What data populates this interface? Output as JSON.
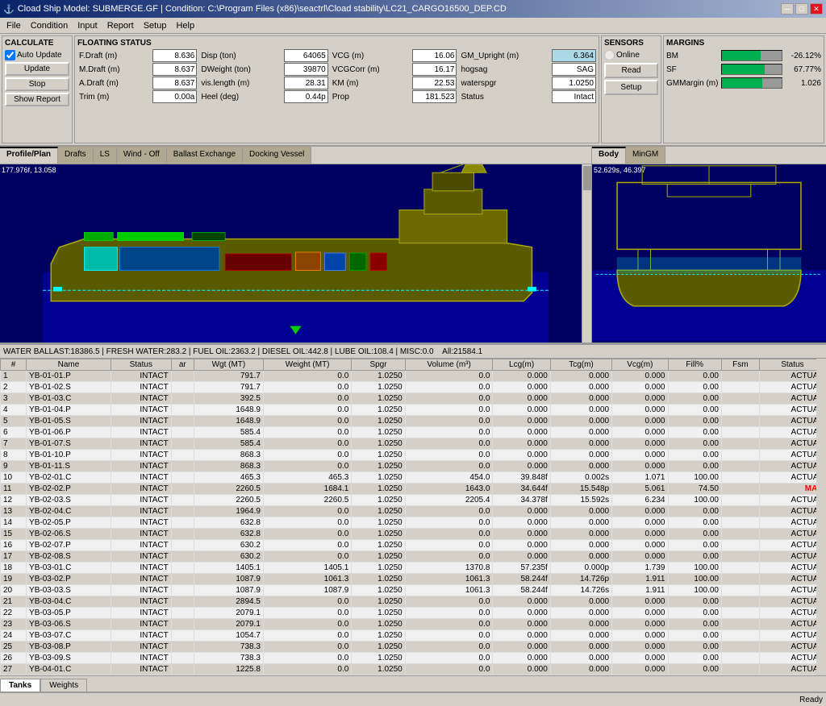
{
  "titleBar": {
    "title": "Cload Ship Model: SUBMERGE.GF | Condition: C:\\Program Files (x86)\\seactrl\\Cload stability\\LC21_CARGO16500_DEP.CD",
    "icon": "ship-icon"
  },
  "menuBar": {
    "items": [
      "File",
      "Condition",
      "Input",
      "Report",
      "Setup",
      "Help"
    ]
  },
  "calculate": {
    "title": "CALCULATE",
    "autoUpdate": "Auto Update",
    "updateBtn": "Update",
    "stopBtn": "Stop",
    "showReportBtn": "Show Report"
  },
  "floatingStatus": {
    "title": "FLOATING STATUS",
    "fields": [
      {
        "label": "F.Draft (m)",
        "value": "8.636"
      },
      {
        "label": "Disp (ton)",
        "value": "64065"
      },
      {
        "label": "VCG (m)",
        "value": "16.06"
      },
      {
        "label": "GM_Upright (m)",
        "value": "6.364"
      },
      {
        "label": "M.Draft (m)",
        "value": "8.637"
      },
      {
        "label": "DWeight (ton)",
        "value": "39870"
      },
      {
        "label": "VCGCorr (m)",
        "value": "16.17"
      },
      {
        "label": "hogsag",
        "value": "SAG"
      },
      {
        "label": "A.Draft (m)",
        "value": "8.637"
      },
      {
        "label": "vis.length (m)",
        "value": "28.31"
      },
      {
        "label": "KM (m)",
        "value": "22.53"
      },
      {
        "label": "waterspgr",
        "value": "1.0250"
      },
      {
        "label": "Trim (m)",
        "value": "0.00a"
      },
      {
        "label": "Heel (deg)",
        "value": "0.44p"
      },
      {
        "label": "Prop",
        "value": "181.523"
      },
      {
        "label": "Status",
        "value": "Intact"
      }
    ]
  },
  "sensors": {
    "title": "SENSORS",
    "onlineBtn": "Online",
    "readBtn": "Read",
    "setupBtn": "Setup"
  },
  "margins": {
    "title": "MARGINS",
    "items": [
      {
        "label": "BM",
        "value": "-26.12%",
        "percent": 65
      },
      {
        "label": "SF",
        "value": "67.77%",
        "percent": 72
      },
      {
        "label": "GMMargin (m)",
        "value": "1.026",
        "percent": 68
      }
    ]
  },
  "profileTabs": [
    "Profile/Plan",
    "Drafts",
    "LS",
    "Wind - Off",
    "Ballast Exchange",
    "Docking Vessel"
  ],
  "profileActiveTab": 0,
  "profileCoords": "177.976f, 13.058",
  "bodyTabs": [
    "Body",
    "MinGM"
  ],
  "bodyActiveTab": 0,
  "bodyCoords": "52.629s, 46.397",
  "ballastBar": "WATER BALLAST:18386.5 | FRESH WATER:283.2 | FUEL OIL:2363.2 | DIESEL OIL:442.8 | LUBE OIL:108.4 | MISC:0.0   All:21584.1",
  "tableHeaders": [
    "#",
    "Name",
    "Status",
    "ar",
    "Wgt (MT)",
    "Weight (MT)",
    "Spgr",
    "Volume (m³)",
    "Lcg(m)",
    "Tcg(m)",
    "Vcg(m)",
    "Fill%",
    "Fsm",
    "Status"
  ],
  "tableRows": [
    [
      "1",
      "YB-01-01.P",
      "INTACT",
      "",
      "791.7",
      "0.0",
      "1.0250",
      "0.0",
      "0.000",
      "0.000",
      "0.000",
      "0.00",
      "",
      "ACTUAL"
    ],
    [
      "2",
      "YB-01-02.S",
      "INTACT",
      "",
      "791.7",
      "0.0",
      "1.0250",
      "0.0",
      "0.000",
      "0.000",
      "0.000",
      "0.00",
      "",
      "ACTUAL"
    ],
    [
      "3",
      "YB-01-03.C",
      "INTACT",
      "",
      "392.5",
      "0.0",
      "1.0250",
      "0.0",
      "0.000",
      "0.000",
      "0.000",
      "0.00",
      "",
      "ACTUAL"
    ],
    [
      "4",
      "YB-01-04.P",
      "INTACT",
      "",
      "1648.9",
      "0.0",
      "1.0250",
      "0.0",
      "0.000",
      "0.000",
      "0.000",
      "0.00",
      "",
      "ACTUAL"
    ],
    [
      "5",
      "YB-01-05.S",
      "INTACT",
      "",
      "1648.9",
      "0.0",
      "1.0250",
      "0.0",
      "0.000",
      "0.000",
      "0.000",
      "0.00",
      "",
      "ACTUAL"
    ],
    [
      "6",
      "YB-01-06.P",
      "INTACT",
      "",
      "585.4",
      "0.0",
      "1.0250",
      "0.0",
      "0.000",
      "0.000",
      "0.000",
      "0.00",
      "",
      "ACTUAL"
    ],
    [
      "7",
      "YB-01-07.S",
      "INTACT",
      "",
      "585.4",
      "0.0",
      "1.0250",
      "0.0",
      "0.000",
      "0.000",
      "0.000",
      "0.00",
      "",
      "ACTUAL"
    ],
    [
      "8",
      "YB-01-10.P",
      "INTACT",
      "",
      "868.3",
      "0.0",
      "1.0250",
      "0.0",
      "0.000",
      "0.000",
      "0.000",
      "0.00",
      "",
      "ACTUAL"
    ],
    [
      "9",
      "YB-01-11.S",
      "INTACT",
      "",
      "868.3",
      "0.0",
      "1.0250",
      "0.0",
      "0.000",
      "0.000",
      "0.000",
      "0.00",
      "",
      "ACTUAL"
    ],
    [
      "10",
      "YB-02-01.C",
      "INTACT",
      "",
      "465.3",
      "465.3",
      "1.0250",
      "454.0",
      "39.848f",
      "0.002s",
      "1.071",
      "100.00",
      "",
      "ACTUAL"
    ],
    [
      "11",
      "YB-02-02.P",
      "INTACT",
      "",
      "2260.5",
      "1684.1",
      "1.0250",
      "1643.0",
      "34.644f",
      "15.548p",
      "5.061",
      "74.50",
      "",
      "MAX"
    ],
    [
      "12",
      "YB-02-03.S",
      "INTACT",
      "",
      "2260.5",
      "2260.5",
      "1.0250",
      "2205.4",
      "34.378f",
      "15.592s",
      "6.234",
      "100.00",
      "",
      "ACTUAL"
    ],
    [
      "13",
      "YB-02-04.C",
      "INTACT",
      "",
      "1964.9",
      "0.0",
      "1.0250",
      "0.0",
      "0.000",
      "0.000",
      "0.000",
      "0.00",
      "",
      "ACTUAL"
    ],
    [
      "14",
      "YB-02-05.P",
      "INTACT",
      "",
      "632.8",
      "0.0",
      "1.0250",
      "0.0",
      "0.000",
      "0.000",
      "0.000",
      "0.00",
      "",
      "ACTUAL"
    ],
    [
      "15",
      "YB-02-06.S",
      "INTACT",
      "",
      "632.8",
      "0.0",
      "1.0250",
      "0.0",
      "0.000",
      "0.000",
      "0.000",
      "0.00",
      "",
      "ACTUAL"
    ],
    [
      "16",
      "YB-02-07.P",
      "INTACT",
      "",
      "630.2",
      "0.0",
      "1.0250",
      "0.0",
      "0.000",
      "0.000",
      "0.000",
      "0.00",
      "",
      "ACTUAL"
    ],
    [
      "17",
      "YB-02-08.S",
      "INTACT",
      "",
      "630.2",
      "0.0",
      "1.0250",
      "0.0",
      "0.000",
      "0.000",
      "0.000",
      "0.00",
      "",
      "ACTUAL"
    ],
    [
      "18",
      "YB-03-01.C",
      "INTACT",
      "",
      "1405.1",
      "1405.1",
      "1.0250",
      "1370.8",
      "57.235f",
      "0.000p",
      "1.739",
      "100.00",
      "",
      "ACTUAL"
    ],
    [
      "19",
      "YB-03-02.P",
      "INTACT",
      "",
      "1087.9",
      "1061.3",
      "1.0250",
      "1061.3",
      "58.244f",
      "14.726p",
      "1.911",
      "100.00",
      "",
      "ACTUAL"
    ],
    [
      "20",
      "YB-03-03.S",
      "INTACT",
      "",
      "1087.9",
      "1087.9",
      "1.0250",
      "1061.3",
      "58.244f",
      "14.726s",
      "1.911",
      "100.00",
      "",
      "ACTUAL"
    ],
    [
      "21",
      "YB-03-04.C",
      "INTACT",
      "",
      "2894.5",
      "0.0",
      "1.0250",
      "0.0",
      "0.000",
      "0.000",
      "0.000",
      "0.00",
      "",
      "ACTUAL"
    ],
    [
      "22",
      "YB-03-05.P",
      "INTACT",
      "",
      "2079.1",
      "0.0",
      "1.0250",
      "0.0",
      "0.000",
      "0.000",
      "0.000",
      "0.00",
      "",
      "ACTUAL"
    ],
    [
      "23",
      "YB-03-06.S",
      "INTACT",
      "",
      "2079.1",
      "0.0",
      "1.0250",
      "0.0",
      "0.000",
      "0.000",
      "0.000",
      "0.00",
      "",
      "ACTUAL"
    ],
    [
      "24",
      "YB-03-07.C",
      "INTACT",
      "",
      "1054.7",
      "0.0",
      "1.0250",
      "0.0",
      "0.000",
      "0.000",
      "0.000",
      "0.00",
      "",
      "ACTUAL"
    ],
    [
      "25",
      "YB-03-08.P",
      "INTACT",
      "",
      "738.3",
      "0.0",
      "1.0250",
      "0.0",
      "0.000",
      "0.000",
      "0.000",
      "0.00",
      "",
      "ACTUAL"
    ],
    [
      "26",
      "YB-03-09.S",
      "INTACT",
      "",
      "738.3",
      "0.0",
      "1.0250",
      "0.0",
      "0.000",
      "0.000",
      "0.000",
      "0.00",
      "",
      "ACTUAL"
    ],
    [
      "27",
      "YB-04-01.C",
      "INTACT",
      "",
      "1225.8",
      "0.0",
      "1.0250",
      "0.0",
      "0.000",
      "0.000",
      "0.000",
      "0.00",
      "",
      "ACTUAL"
    ]
  ],
  "bottomTabs": [
    "Tanks",
    "Weights"
  ],
  "bottomActiveTab": 0,
  "statusBar": "Ready"
}
